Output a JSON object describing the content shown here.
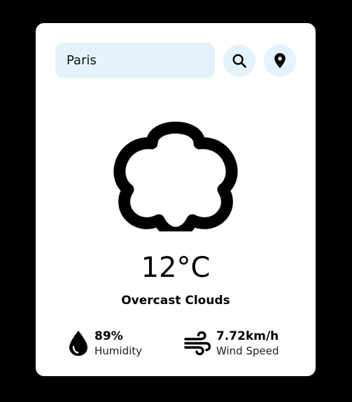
{
  "search": {
    "value": "Paris",
    "placeholder": ""
  },
  "buttons": {
    "search_icon": "magnifier-icon",
    "location_icon": "map-pin-icon"
  },
  "weather": {
    "icon": "cloud-icon",
    "temperature": "12°C",
    "condition": "Overcast Clouds"
  },
  "stats": {
    "humidity": {
      "icon": "water-drop-icon",
      "value": "89%",
      "label": "Humidity"
    },
    "wind": {
      "icon": "wind-icon",
      "value": "7.72km/h",
      "label": "Wind Speed"
    }
  },
  "colors": {
    "background": "#000000",
    "card": "#ffffff",
    "accent_light": "#e3f2fb",
    "text": "#000000"
  }
}
